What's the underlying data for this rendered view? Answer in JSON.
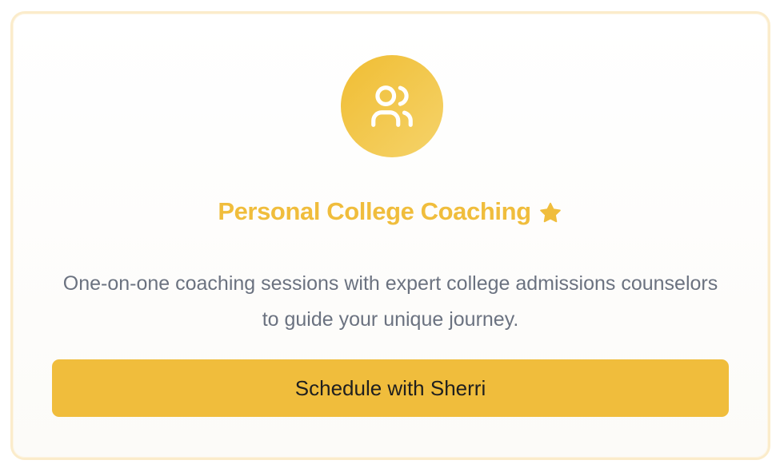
{
  "card": {
    "icon": "users-icon",
    "title": "Personal College Coaching",
    "title_badge_icon": "star-icon",
    "description": "One-on-one coaching sessions with expert college admissions counselors to guide your unique journey.",
    "cta_label": "Schedule with Sherri"
  },
  "colors": {
    "accent": "#f0bd3c",
    "text_muted": "#6b7280",
    "border": "#fbeccb"
  }
}
